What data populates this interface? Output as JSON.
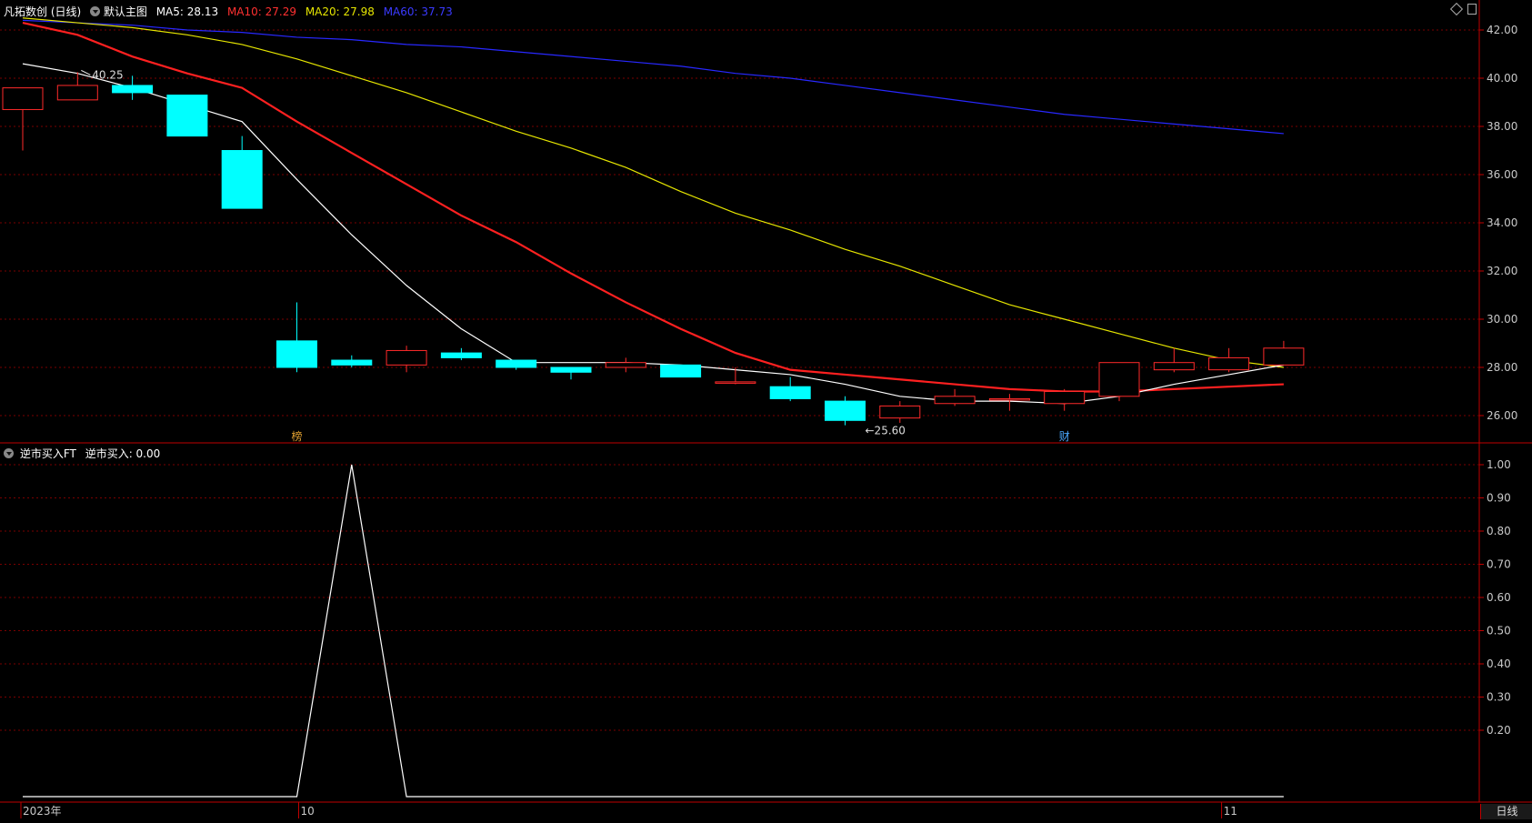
{
  "main_header": {
    "stock_name": "凡拓数创 (日线)",
    "template": "默认主图",
    "ma5": "MA5: 28.13",
    "ma10": "MA10: 27.29",
    "ma20": "MA20: 27.98",
    "ma60": "MA60: 37.73"
  },
  "sub_header": {
    "indicator": "逆市买入FT",
    "value": "逆市买入: 0.00"
  },
  "top_right_icon": "diamond-icon",
  "colors": {
    "up": "#ff2a2a",
    "down": "#00ffff",
    "ma5": "#ffffff",
    "ma10": "#ff2020",
    "ma20": "#e6e600",
    "ma60": "#2828ff",
    "grid": "#7a0000",
    "axis": "#c00000"
  },
  "chart_data": [
    {
      "type": "candlestick",
      "title": "凡拓数创 (日线)",
      "y_axis_ticks": [
        "42.00",
        "40.00",
        "38.00",
        "36.00",
        "34.00",
        "32.00",
        "30.00",
        "28.00",
        "26.00"
      ],
      "ylim": [
        25.2,
        42.6
      ],
      "candles": [
        {
          "o": 38.7,
          "c": 39.6,
          "h": 39.6,
          "l": 37.0
        },
        {
          "o": 39.1,
          "c": 39.7,
          "h": 40.25,
          "l": 39.1
        },
        {
          "o": 39.7,
          "c": 39.4,
          "h": 40.1,
          "l": 39.1
        },
        {
          "o": 39.3,
          "c": 37.6,
          "h": 39.3,
          "l": 37.6
        },
        {
          "o": 37.0,
          "c": 34.6,
          "h": 37.6,
          "l": 34.6
        },
        {
          "o": 29.1,
          "c": 28.0,
          "h": 30.7,
          "l": 27.8
        },
        {
          "o": 28.3,
          "c": 28.1,
          "h": 28.5,
          "l": 28.0
        },
        {
          "o": 28.1,
          "c": 28.7,
          "h": 28.9,
          "l": 27.8
        },
        {
          "o": 28.6,
          "c": 28.4,
          "h": 28.8,
          "l": 28.3
        },
        {
          "o": 28.3,
          "c": 28.0,
          "h": 28.3,
          "l": 27.9
        },
        {
          "o": 28.0,
          "c": 27.8,
          "h": 28.0,
          "l": 27.5
        },
        {
          "o": 28.0,
          "c": 28.2,
          "h": 28.4,
          "l": 27.8
        },
        {
          "o": 28.1,
          "c": 27.6,
          "h": 28.1,
          "l": 27.6
        },
        {
          "o": 27.4,
          "c": 27.4,
          "h": 28.0,
          "l": 27.3
        },
        {
          "o": 27.2,
          "c": 26.7,
          "h": 27.6,
          "l": 26.6
        },
        {
          "o": 26.6,
          "c": 25.8,
          "h": 26.8,
          "l": 25.6
        },
        {
          "o": 25.9,
          "c": 26.4,
          "h": 26.6,
          "l": 25.7
        },
        {
          "o": 26.5,
          "c": 26.8,
          "h": 27.1,
          "l": 26.4
        },
        {
          "o": 26.7,
          "c": 26.7,
          "h": 26.9,
          "l": 26.2
        },
        {
          "o": 26.5,
          "c": 27.0,
          "h": 27.1,
          "l": 26.2
        },
        {
          "o": 26.8,
          "c": 28.2,
          "h": 28.2,
          "l": 26.6
        },
        {
          "o": 27.9,
          "c": 28.2,
          "h": 28.8,
          "l": 27.8
        },
        {
          "o": 27.9,
          "c": 28.4,
          "h": 28.8,
          "l": 27.8
        },
        {
          "o": 28.1,
          "c": 28.8,
          "h": 29.1,
          "l": 28.1
        }
      ],
      "ma5": [
        40.6,
        40.2,
        39.6,
        38.9,
        38.2,
        35.8,
        33.5,
        31.4,
        29.6,
        28.2,
        28.2,
        28.2,
        28.1,
        27.9,
        27.7,
        27.3,
        26.8,
        26.6,
        26.6,
        26.5,
        26.8,
        27.3,
        27.7,
        28.1
      ],
      "ma10": [
        42.3,
        41.8,
        40.9,
        40.2,
        39.6,
        38.2,
        36.9,
        35.6,
        34.3,
        33.2,
        31.9,
        30.7,
        29.6,
        28.6,
        27.9,
        27.7,
        27.5,
        27.3,
        27.1,
        27.0,
        27.0,
        27.1,
        27.2,
        27.3
      ],
      "ma20": [
        42.5,
        42.3,
        42.1,
        41.8,
        41.4,
        40.8,
        40.1,
        39.4,
        38.6,
        37.8,
        37.1,
        36.3,
        35.3,
        34.4,
        33.7,
        32.9,
        32.2,
        31.4,
        30.6,
        30.0,
        29.4,
        28.8,
        28.3,
        28.0
      ],
      "ma60": [
        42.4,
        42.3,
        42.2,
        42.0,
        41.9,
        41.7,
        41.6,
        41.4,
        41.3,
        41.1,
        40.9,
        40.7,
        40.5,
        40.2,
        40.0,
        39.7,
        39.4,
        39.1,
        38.8,
        38.5,
        38.3,
        38.1,
        37.9,
        37.7
      ],
      "annotations": [
        {
          "label": "40.25",
          "candle": 1,
          "value": 40.25
        },
        {
          "label": "←25.60",
          "candle": 15,
          "value": 25.6
        }
      ],
      "event_markers": [
        {
          "label": "榜",
          "candle": 5
        },
        {
          "label": "财",
          "candle": 19
        }
      ],
      "grid": true
    },
    {
      "type": "line",
      "title": "逆市买入FT",
      "series": [
        {
          "name": "逆市买入",
          "values": [
            0,
            0,
            0,
            0,
            0,
            0,
            1,
            0,
            0,
            0,
            0,
            0,
            0,
            0,
            0,
            0,
            0,
            0,
            0,
            0,
            0,
            0,
            0,
            0
          ]
        }
      ],
      "y_axis_ticks": [
        "1.00",
        "0.90",
        "0.80",
        "0.70",
        "0.60",
        "0.50",
        "0.40",
        "0.30",
        "0.20"
      ],
      "ylim": [
        0,
        1.0
      ],
      "grid": true
    }
  ],
  "x_axis": {
    "labels": [
      {
        "text": "2023年",
        "candle": 0
      },
      {
        "text": "10",
        "candle": 5
      },
      {
        "text": "11",
        "candle": 22
      }
    ]
  },
  "period_button": "日线"
}
